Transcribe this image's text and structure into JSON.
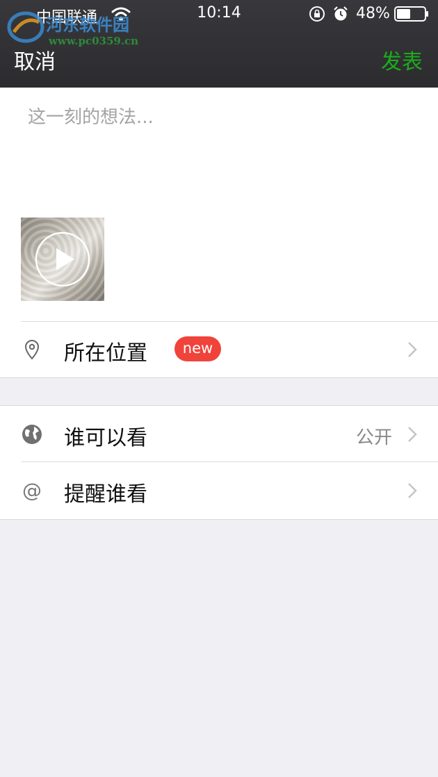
{
  "status_bar": {
    "carrier": "中国联通",
    "time": "10:14",
    "battery": "48%"
  },
  "watermark": {
    "brand": "河东软件园",
    "url": "www.pc0359.cn"
  },
  "nav": {
    "cancel_label": "取消",
    "publish_label": "发表",
    "publish_color": "#1aad19"
  },
  "compose": {
    "placeholder": "这一刻的想法...",
    "value": "",
    "attachment_icon": "play-icon"
  },
  "location": {
    "label": "所在位置",
    "badge": "new",
    "icon": "location-pin-icon"
  },
  "visibility": {
    "label": "谁可以看",
    "value": "公开",
    "icon": "globe-icon"
  },
  "mention": {
    "label": "提醒谁看",
    "icon": "at-icon"
  },
  "colors": {
    "badge_red": "#f0433a",
    "background": "#efeff4"
  }
}
